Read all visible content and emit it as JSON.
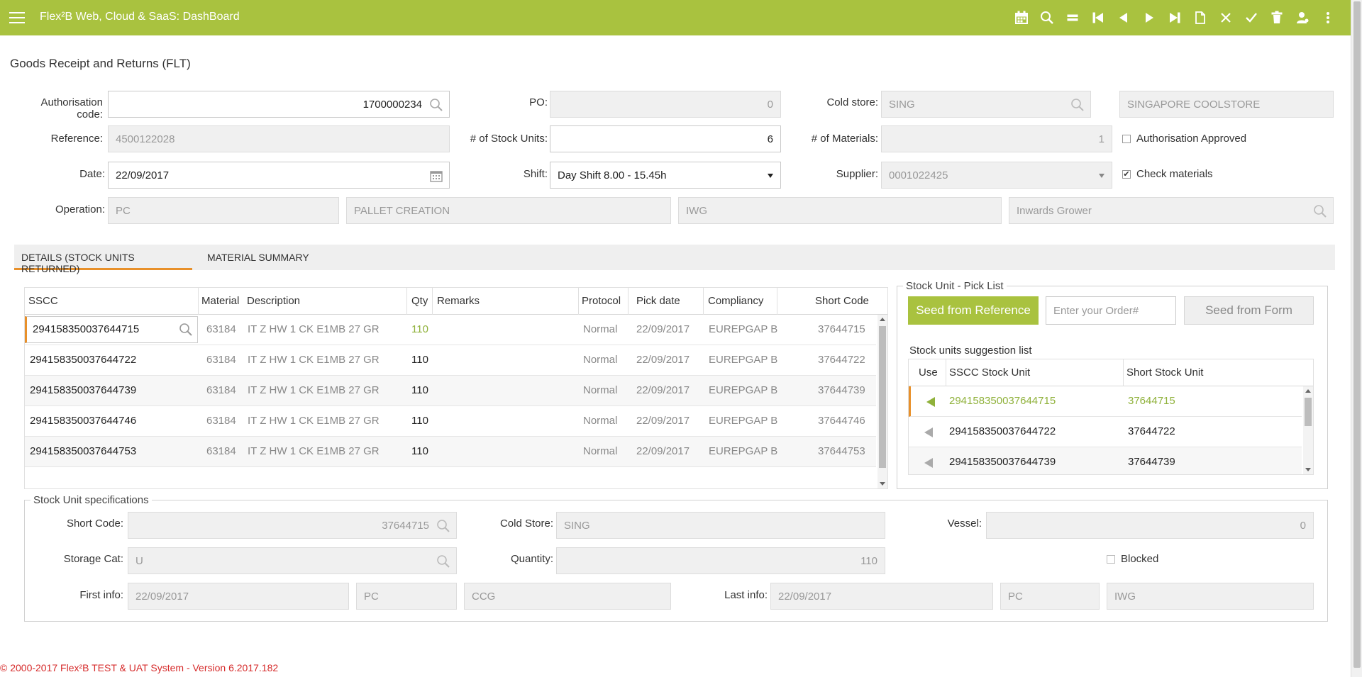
{
  "header": {
    "app_title": "Flex²B Web, Cloud & SaaS: DashBoard",
    "toolbar_icons": [
      "calendar-icon",
      "search-icon",
      "equals-icon",
      "first-record-icon",
      "previous-record-icon",
      "next-record-icon",
      "last-record-icon",
      "new-document-icon",
      "close-icon",
      "check-icon",
      "delete-icon",
      "user-icon",
      "more-vert-icon"
    ]
  },
  "page": {
    "title": "Goods Receipt and Returns (FLT)"
  },
  "form": {
    "auth_code_label": "Authorisation code:",
    "auth_code_value": "1700000234",
    "po_label": "PO:",
    "po_value": "0",
    "cold_store_label": "Cold store:",
    "cold_store_code": "SING",
    "cold_store_name": "SINGAPORE COOLSTORE",
    "reference_label": "Reference:",
    "reference_value": "4500122028",
    "stock_units_label": "# of Stock Units:",
    "stock_units_value": "6",
    "materials_label": "# of Materials:",
    "materials_value": "1",
    "auth_approved_label": "Authorisation Approved",
    "date_label": "Date:",
    "date_value": "22/09/2017",
    "shift_label": "Shift:",
    "shift_value": "Day Shift 8.00 - 15.45h",
    "supplier_label": "Supplier:",
    "supplier_value": "0001022425",
    "check_materials_label": "Check materials",
    "check_materials_checked": true,
    "operation_label": "Operation:",
    "operation_code": "PC",
    "operation_name": "PALLET CREATION",
    "operation_code2": "IWG",
    "operation_name2": "Inwards Grower"
  },
  "tabs": [
    {
      "label": "DETAILS (STOCK UNITS RETURNED)",
      "active": true
    },
    {
      "label": "MATERIAL SUMMARY",
      "active": false
    }
  ],
  "grid": {
    "columns": [
      "SSCC",
      "Material",
      "Description",
      "Qty",
      "Remarks",
      "Protocol",
      "Pick date",
      "Compliancy",
      "Short Code"
    ],
    "rows": [
      {
        "sscc": "294158350037644715",
        "material": "63184",
        "description": "IT Z HW 1 CK E1MB 27 GR",
        "qty": "110",
        "remarks": "",
        "protocol": "Normal",
        "pick_date": "22/09/2017",
        "compliancy": "EUREPGAP B",
        "short_code": "37644715"
      },
      {
        "sscc": "294158350037644722",
        "material": "63184",
        "description": "IT Z HW 1 CK E1MB 27 GR",
        "qty": "110",
        "remarks": "",
        "protocol": "Normal",
        "pick_date": "22/09/2017",
        "compliancy": "EUREPGAP B",
        "short_code": "37644722"
      },
      {
        "sscc": "294158350037644739",
        "material": "63184",
        "description": "IT Z HW 1 CK E1MB 27 GR",
        "qty": "110",
        "remarks": "",
        "protocol": "Normal",
        "pick_date": "22/09/2017",
        "compliancy": "EUREPGAP B",
        "short_code": "37644739"
      },
      {
        "sscc": "294158350037644746",
        "material": "63184",
        "description": "IT Z HW 1 CK E1MB 27 GR",
        "qty": "110",
        "remarks": "",
        "protocol": "Normal",
        "pick_date": "22/09/2017",
        "compliancy": "EUREPGAP B",
        "short_code": "37644746"
      },
      {
        "sscc": "294158350037644753",
        "material": "63184",
        "description": "IT Z HW 1 CK E1MB 27 GR",
        "qty": "110",
        "remarks": "",
        "protocol": "Normal",
        "pick_date": "22/09/2017",
        "compliancy": "EUREPGAP B",
        "short_code": "37644753"
      }
    ]
  },
  "pick_list": {
    "legend": "Stock Unit - Pick List",
    "seed_ref_button": "Seed from Reference",
    "order_placeholder": "Enter your Order#",
    "seed_form_button": "Seed from Form",
    "suggestion_title": "Stock units suggestion list",
    "columns": [
      "Use",
      "SSCC Stock Unit",
      "Short Stock Unit"
    ],
    "rows": [
      {
        "sscc": "294158350037644715",
        "short": "37644715"
      },
      {
        "sscc": "294158350037644722",
        "short": "37644722"
      },
      {
        "sscc": "294158350037644739",
        "short": "37644739"
      }
    ]
  },
  "specs": {
    "legend": "Stock Unit specifications",
    "short_code_label": "Short Code:",
    "short_code_value": "37644715",
    "cold_store_label": "Cold Store:",
    "cold_store_value": "SING",
    "vessel_label": "Vessel:",
    "vessel_value": "0",
    "storage_cat_label": "Storage Cat:",
    "storage_cat_value": "U",
    "quantity_label": "Quantity:",
    "quantity_value": "110",
    "blocked_label": "Blocked",
    "first_info_label": "First info:",
    "first_info_date": "22/09/2017",
    "first_info_code": "PC",
    "first_info_code2": "CCG",
    "last_info_label": "Last info:",
    "last_info_date": "22/09/2017",
    "last_info_code": "PC",
    "last_info_code2": "IWG"
  },
  "footer": {
    "text": "© 2000-2017 Flex²B TEST & UAT System - Version 6.2017.182"
  },
  "colors": {
    "brand": "#a9c23f",
    "accent": "#e8902a",
    "footer": "#d62b2b"
  }
}
